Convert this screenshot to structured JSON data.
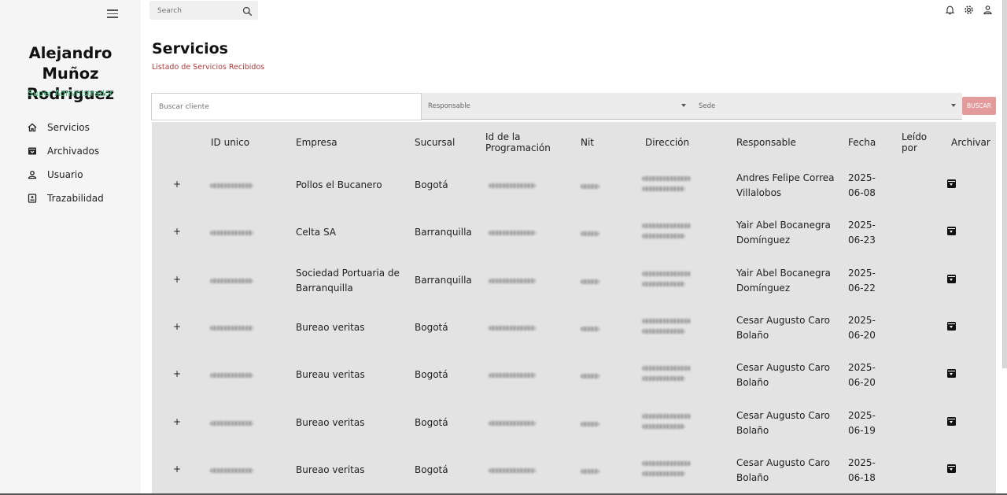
{
  "sidebar": {
    "user_name": "Alejandro Muñoz Rodriguez",
    "user_role": "Super Administrador",
    "items": [
      {
        "label": "Servicios",
        "icon": "home-icon"
      },
      {
        "label": "Archivados",
        "icon": "archive-icon"
      },
      {
        "label": "Usuario",
        "icon": "user-icon"
      },
      {
        "label": "Trazabilidad",
        "icon": "trace-icon"
      }
    ]
  },
  "topbar": {
    "search_placeholder": "Search"
  },
  "page": {
    "title": "Servicios",
    "subtitle": "Listado de Servicios Recibidos"
  },
  "filters": {
    "client_placeholder": "Buscar cliente",
    "responsable_label": "Responsable",
    "sede_label": "Sede",
    "search_button": "BUSCAR"
  },
  "table": {
    "headers": {
      "id": "ID unico",
      "empresa": "Empresa",
      "sucursal": "Sucursal",
      "programacion_1": "Id de la",
      "programacion_2": "Programación",
      "nit": "Nit",
      "direccion": "Dirección",
      "responsable": "Responsable",
      "fecha": "Fecha",
      "leido_1": "Leído",
      "leido_2": "por",
      "archivar": "Archivar"
    },
    "rows": [
      {
        "empresa_1": "Pollos el Bucanero",
        "empresa_2": "",
        "sucursal": "Bogotá",
        "responsable_1": "Andres Felipe Correa",
        "responsable_2": "Villalobos",
        "fecha_1": "2025-",
        "fecha_2": "06-08"
      },
      {
        "empresa_1": "Celta SA",
        "empresa_2": "",
        "sucursal": "Barranquilla",
        "responsable_1": "Yair Abel Bocanegra",
        "responsable_2": "Domínguez",
        "fecha_1": "2025-",
        "fecha_2": "06-23"
      },
      {
        "empresa_1": "Sociedad Portuaria de",
        "empresa_2": "Barranquilla",
        "sucursal": "Barranquilla",
        "responsable_1": "Yair Abel Bocanegra",
        "responsable_2": "Domínguez",
        "fecha_1": "2025-",
        "fecha_2": "06-22"
      },
      {
        "empresa_1": "Bureao veritas",
        "empresa_2": "",
        "sucursal": "Bogotá",
        "responsable_1": "Cesar Augusto Caro",
        "responsable_2": "Bolaño",
        "fecha_1": "2025-",
        "fecha_2": "06-20"
      },
      {
        "empresa_1": "Bureau veritas",
        "empresa_2": "",
        "sucursal": "Bogotá",
        "responsable_1": "Cesar Augusto Caro",
        "responsable_2": "Bolaño",
        "fecha_1": "2025-",
        "fecha_2": "06-20"
      },
      {
        "empresa_1": "Bureao veritas",
        "empresa_2": "",
        "sucursal": "Bogotá",
        "responsable_1": "Cesar Augusto Caro",
        "responsable_2": "Bolaño",
        "fecha_1": "2025-",
        "fecha_2": "06-19"
      },
      {
        "empresa_1": "Bureao veritas",
        "empresa_2": "",
        "sucursal": "Bogotá",
        "responsable_1": "Cesar Augusto Caro",
        "responsable_2": "Bolaño",
        "fecha_1": "2025-",
        "fecha_2": "06-18"
      }
    ]
  },
  "colors": {
    "accent_role": "#4cc38a",
    "subtitle": "#b23a3a",
    "button": "#e39a9a",
    "table_bg": "#e3e3e3"
  }
}
